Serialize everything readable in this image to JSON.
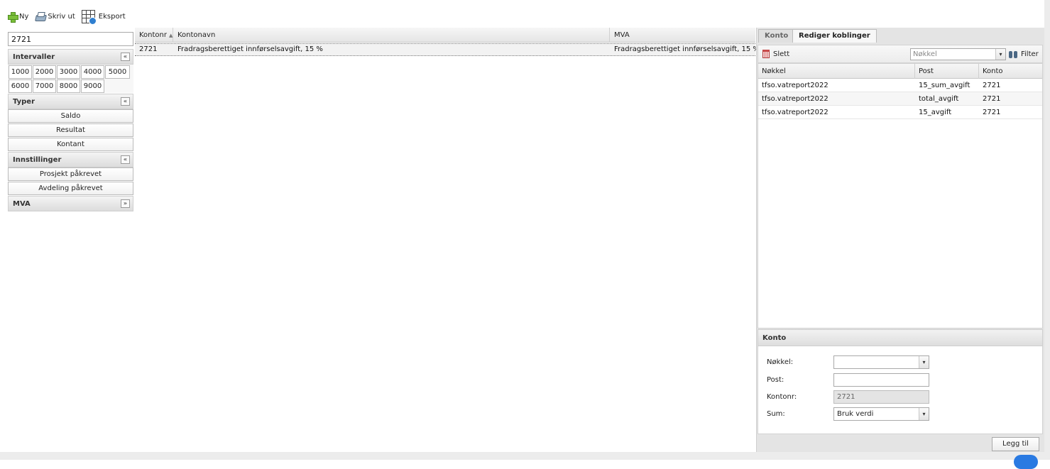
{
  "toolbar": {
    "new_label": "Ny",
    "print_label": "Skriv ut",
    "export_label": "Eksport"
  },
  "left": {
    "search_value": "2721",
    "intervals": {
      "title": "Intervaller",
      "items": [
        "1000",
        "2000",
        "3000",
        "4000",
        "5000",
        "6000",
        "7000",
        "8000",
        "9000"
      ]
    },
    "types": {
      "title": "Typer",
      "items": [
        "Saldo",
        "Resultat",
        "Kontant"
      ]
    },
    "settings": {
      "title": "Innstillinger",
      "items": [
        "Prosjekt påkrevet",
        "Avdeling påkrevet"
      ]
    },
    "mva": {
      "title": "MVA"
    },
    "toggle_up_glyph": "«",
    "toggle_down_glyph": "»"
  },
  "grid": {
    "columns": [
      "Kontonr",
      "Kontonavn",
      "MVA"
    ],
    "sort_indicator": "▲",
    "rows": [
      {
        "kontonr": "2721",
        "kontonavn": "Fradragsberettiget innførselsavgift, 15 %",
        "mva": "Fradragsberettiget innførselsavgift, 15 %"
      }
    ]
  },
  "right": {
    "tabs": [
      {
        "label": "Konto",
        "active": false
      },
      {
        "label": "Rediger koblinger",
        "active": true
      }
    ],
    "toolbar": {
      "delete_label": "Slett",
      "key_placeholder": "Nøkkel",
      "filter_label": "Filter"
    },
    "links_grid": {
      "columns": [
        "Nøkkel",
        "Post",
        "Konto"
      ],
      "rows": [
        {
          "key": "tfso.vatreport2022",
          "post": "15_sum_avgift",
          "konto": "2721"
        },
        {
          "key": "tfso.vatreport2022",
          "post": "total_avgift",
          "konto": "2721"
        },
        {
          "key": "tfso.vatreport2022",
          "post": "15_avgift",
          "konto": "2721"
        }
      ]
    },
    "form": {
      "title": "Konto",
      "key_label": "Nøkkel:",
      "key_value": "",
      "post_label": "Post:",
      "post_value": "",
      "kontonr_label": "Kontonr:",
      "kontonr_value": "2721",
      "sum_label": "Sum:",
      "sum_value": "Bruk verdi",
      "add_button": "Legg til"
    }
  },
  "icons": {
    "new": "plus-icon",
    "print": "printer-icon",
    "export": "spreadsheet-export-icon",
    "delete": "trash-icon",
    "filter": "binoculars-icon",
    "dropdown": "chevron-down-icon",
    "dropdown_glyph": "▾"
  },
  "colors": {
    "accent_green": "#7bbf3a",
    "delete_red": "#c84a4a",
    "selected_row": "#f2f2f2",
    "panel_gray": "#e4e4e4"
  }
}
